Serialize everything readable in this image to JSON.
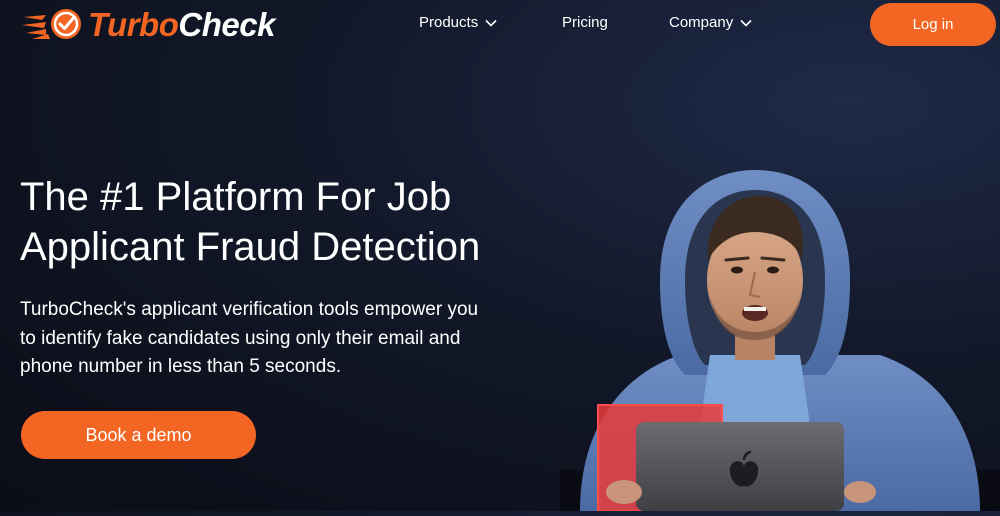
{
  "brand": {
    "name_part1": "Turbo",
    "name_part2": "Check",
    "accent_color": "#f26522"
  },
  "nav": {
    "items": [
      {
        "label": "Products",
        "has_dropdown": true,
        "icon": "chevron-down-icon"
      },
      {
        "label": "Pricing",
        "has_dropdown": false
      },
      {
        "label": "Company",
        "has_dropdown": true,
        "icon": "chevron-down-icon"
      }
    ],
    "login_label": "Log in"
  },
  "hero": {
    "title_line1": "The #1 Platform For Job",
    "title_line2": "Applicant Fraud Detection",
    "description_line1": "TurboCheck's applicant verification tools empower you",
    "description_line2": "to identify fake candidates using only their email and",
    "description_line3": "phone number in less than 5 seconds.",
    "cta_label": "Book a demo",
    "image_alt": "Man in blue hoodie using laptop"
  },
  "colors": {
    "background": "#0f1322",
    "button": "#f26522",
    "text": "#ffffff"
  }
}
